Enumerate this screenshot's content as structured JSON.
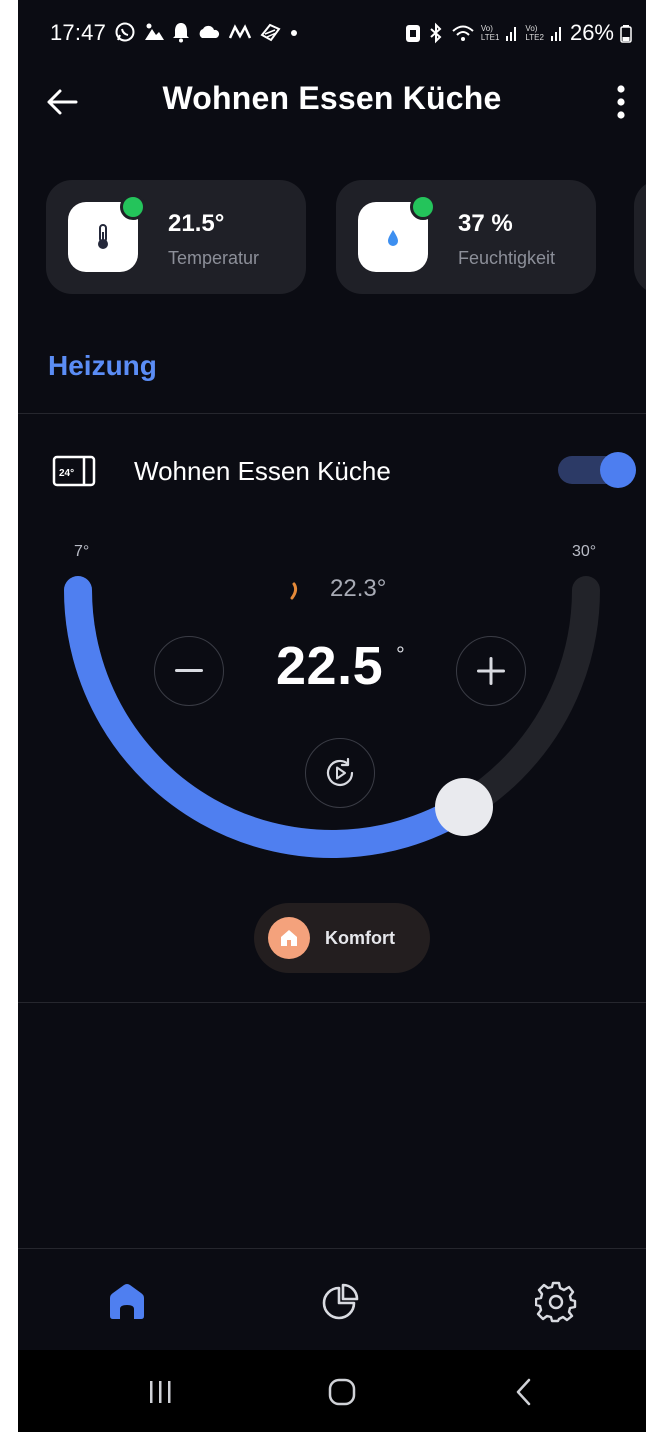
{
  "status_bar": {
    "time": "17:47",
    "left_icons": [
      "whatsapp-icon",
      "image-icon",
      "bell-icon",
      "cloud-icon",
      "m-icon",
      "feather-icon",
      "dot-icon"
    ],
    "right_icons": [
      "battery-saver-icon",
      "bluetooth-icon",
      "wifi-icon",
      "lte1-signal-icon",
      "lte2-signal-icon"
    ],
    "sim1": {
      "top": "Vo)",
      "bottom": "LTE1"
    },
    "sim2": {
      "top": "Vo)",
      "bottom": "LTE2"
    },
    "battery": "26%"
  },
  "header": {
    "title": "Wohnen Essen Küche",
    "back_icon": "arrow-left-icon",
    "menu_icon": "more-vertical-icon"
  },
  "sensors": [
    {
      "value": "21.5°",
      "label": "Temperatur",
      "icon": "thermometer-icon",
      "status_color": "#24c45b"
    },
    {
      "value": "37 %",
      "label": "Feuchtigkeit",
      "icon": "water-drop-icon",
      "status_color": "#24c45b"
    }
  ],
  "section": {
    "title": "Heizung"
  },
  "heating": {
    "device_icon": "thermostat-display-icon",
    "device_name": "Wohnen Essen Küche",
    "enabled": true
  },
  "dial": {
    "min_label": "7°",
    "max_label": "30°",
    "min": 7,
    "max": 30,
    "current_temp": "22.3°",
    "target_value": "22.5",
    "target_unit": "°",
    "target_fraction": 0.674,
    "accent": "#4f7ff0",
    "track_color": "#222329"
  },
  "mode": {
    "label": "Komfort",
    "icon": "home-icon",
    "color": "#f4a27c"
  },
  "bottom_nav": [
    {
      "name": "home",
      "icon": "home-icon",
      "active": true
    },
    {
      "name": "statistics",
      "icon": "pie-chart-icon",
      "active": false
    },
    {
      "name": "settings",
      "icon": "gear-icon",
      "active": false
    }
  ],
  "system_nav": [
    "recents-icon",
    "home-circle-icon",
    "back-chevron-icon"
  ],
  "colors": {
    "background": "#0b0c13",
    "card": "#1f2027",
    "accent": "#5b8df5",
    "online": "#24c45b"
  }
}
